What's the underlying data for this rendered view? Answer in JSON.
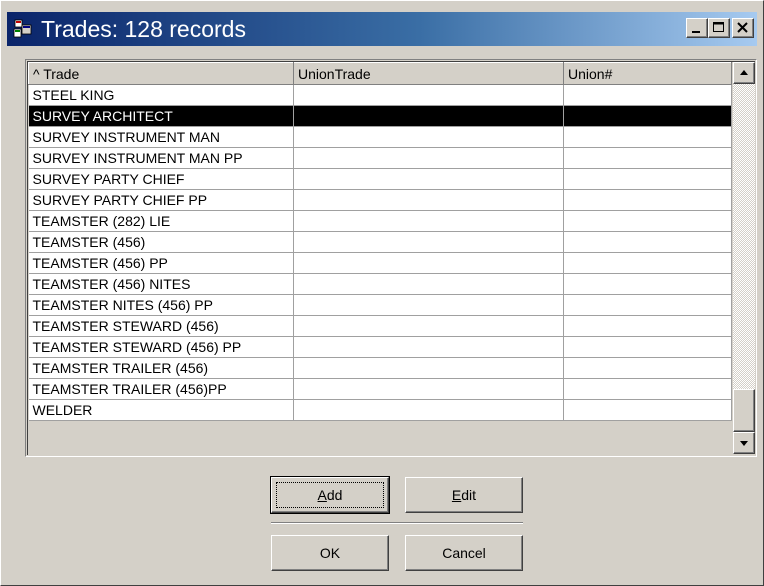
{
  "window": {
    "title": "Trades: 128 records",
    "titlebar_gradient": [
      "#0a246a",
      "#a6caf0"
    ]
  },
  "grid": {
    "columns": [
      "^ Trade",
      "UnionTrade",
      "Union#"
    ],
    "rows": [
      {
        "trade": "STEEL KING",
        "union_trade": "",
        "union_num": ""
      },
      {
        "trade": "SURVEY ARCHITECT",
        "union_trade": "",
        "union_num": "",
        "selected": true
      },
      {
        "trade": "SURVEY INSTRUMENT MAN",
        "union_trade": "",
        "union_num": ""
      },
      {
        "trade": "SURVEY INSTRUMENT MAN PP",
        "union_trade": "",
        "union_num": ""
      },
      {
        "trade": "SURVEY PARTY CHIEF",
        "union_trade": "",
        "union_num": ""
      },
      {
        "trade": "SURVEY PARTY CHIEF  PP",
        "union_trade": "",
        "union_num": ""
      },
      {
        "trade": "TEAMSTER (282) LIE",
        "union_trade": "",
        "union_num": ""
      },
      {
        "trade": "TEAMSTER (456)",
        "union_trade": "",
        "union_num": ""
      },
      {
        "trade": "TEAMSTER (456)  PP",
        "union_trade": "",
        "union_num": ""
      },
      {
        "trade": "TEAMSTER (456) NITES",
        "union_trade": "",
        "union_num": ""
      },
      {
        "trade": "TEAMSTER NITES   (456) PP",
        "union_trade": "",
        "union_num": ""
      },
      {
        "trade": "TEAMSTER STEWARD (456)",
        "union_trade": "",
        "union_num": ""
      },
      {
        "trade": "TEAMSTER STEWARD (456) PP",
        "union_trade": "",
        "union_num": ""
      },
      {
        "trade": "TEAMSTER TRAILER (456)",
        "union_trade": "",
        "union_num": ""
      },
      {
        "trade": "TEAMSTER TRAILER (456)PP",
        "union_trade": "",
        "union_num": ""
      },
      {
        "trade": "WELDER",
        "union_trade": "",
        "union_num": ""
      }
    ],
    "selected_row_color": "#000000"
  },
  "buttons": {
    "add": {
      "accel": "A",
      "rest": "dd"
    },
    "edit": {
      "accel": "E",
      "rest": "dit"
    },
    "ok": "OK",
    "cancel": "Cancel"
  },
  "icons": {
    "app": "app-grid-icon",
    "minimize": "minimize-icon",
    "maximize": "maximize-icon",
    "close": "close-icon",
    "scroll_up": "scroll-up-arrow-icon",
    "scroll_down": "scroll-down-arrow-icon"
  }
}
